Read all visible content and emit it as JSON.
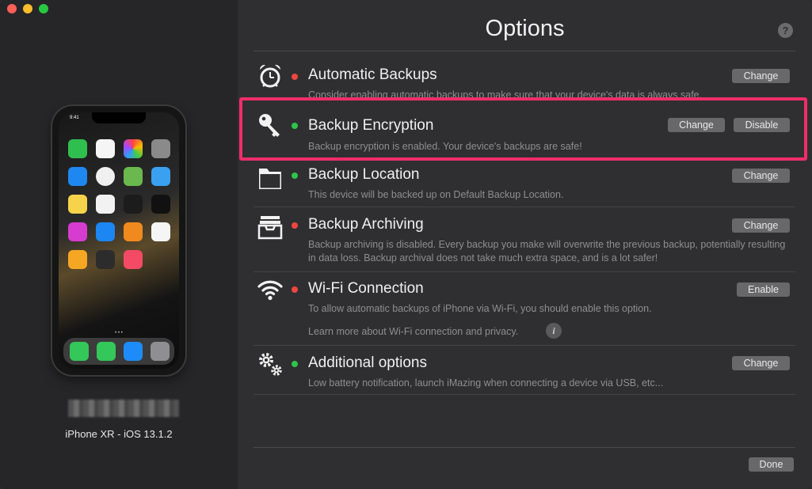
{
  "window": {
    "title": "Options"
  },
  "device": {
    "model": "iPhone XR - iOS 13.1.2",
    "status_time": "9:41"
  },
  "options": [
    {
      "id": "automatic-backups",
      "title": "Automatic Backups",
      "status": "red",
      "description": "Consider enabling automatic backups to make sure that your device's data is always safe.",
      "buttons": [
        "Change"
      ],
      "icon": "alarm-clock-icon"
    },
    {
      "id": "backup-encryption",
      "title": "Backup Encryption",
      "status": "green",
      "description": "Backup encryption is enabled. Your device's backups are safe!",
      "buttons": [
        "Change",
        "Disable"
      ],
      "icon": "key-icon",
      "highlighted": true
    },
    {
      "id": "backup-location",
      "title": "Backup Location",
      "status": "green",
      "description": "This device will be backed up on Default Backup Location.",
      "buttons": [
        "Change"
      ],
      "icon": "folder-icon"
    },
    {
      "id": "backup-archiving",
      "title": "Backup Archiving",
      "status": "red",
      "description": "Backup archiving is disabled. Every backup you make will overwrite the previous backup, potentially resulting in data loss. Backup archival does not take much extra space, and is a lot safer!",
      "buttons": [
        "Change"
      ],
      "icon": "archive-tray-icon"
    },
    {
      "id": "wifi-connection",
      "title": "Wi-Fi Connection",
      "status": "red",
      "description": "To allow automatic backups of iPhone via Wi-Fi, you should enable this option.",
      "learn_more": "Learn more about Wi-Fi connection and privacy.",
      "buttons": [
        "Enable"
      ],
      "icon": "wifi-icon"
    },
    {
      "id": "additional-options",
      "title": "Additional options",
      "status": "green",
      "description": "Low battery notification, launch iMazing when connecting a device via USB, etc...",
      "buttons": [
        "Change"
      ],
      "icon": "gears-icon"
    }
  ],
  "footer": {
    "done_label": "Done"
  },
  "help_label": "?",
  "info_label": "i",
  "colors": {
    "status_red": "#f0463e",
    "status_green": "#2ec44a",
    "highlight": "#f02d6a",
    "button": "#68686a"
  }
}
